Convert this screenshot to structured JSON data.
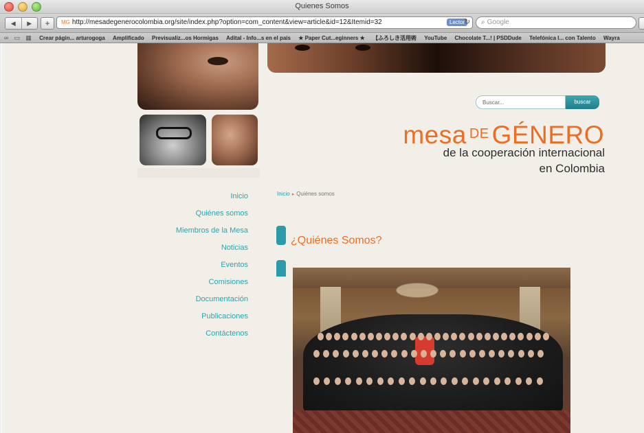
{
  "browser": {
    "window_title": "Quienes Somos",
    "url": "http://mesadegenerocolombia.org/site/index.php?option=com_content&view=article&id=12&Itemid=32",
    "url_prefix": "MG",
    "lector_label": "Lector",
    "search_placeholder": "Google",
    "bookmarks": [
      "Crear págin... arturogoga",
      "Amplificado",
      "Previsualiz...os Hormigas",
      "Adital - Info...s en el país",
      "★ Paper Cut...eginners ★",
      "【ふろしき活用術",
      "YouTube",
      "Chocolate T...! | PSDDude",
      "Telefónica I... con Talento",
      "Wayra"
    ]
  },
  "site": {
    "search_placeholder": "Buscar...",
    "search_button": "buscar",
    "logo": {
      "word1": "mesa",
      "word2": "DE",
      "word3": "GÉNERO",
      "line2": "de la cooperación internacional",
      "line3": "en Colombia"
    },
    "nav": [
      "Inicio",
      "Quiénes somos",
      "Miembros de la Mesa",
      "Noticias",
      "Eventos",
      "Comisiones",
      "Documentación",
      "Publicaciones",
      "Contáctenos"
    ],
    "breadcrumb": {
      "home": "Inicio",
      "current": "Quiénes somos"
    },
    "title": "¿Quiénes Somos?"
  },
  "colors": {
    "accent_teal": "#2aa4b0",
    "accent_orange": "#ec6e25",
    "page_bg": "#f2efe8"
  }
}
